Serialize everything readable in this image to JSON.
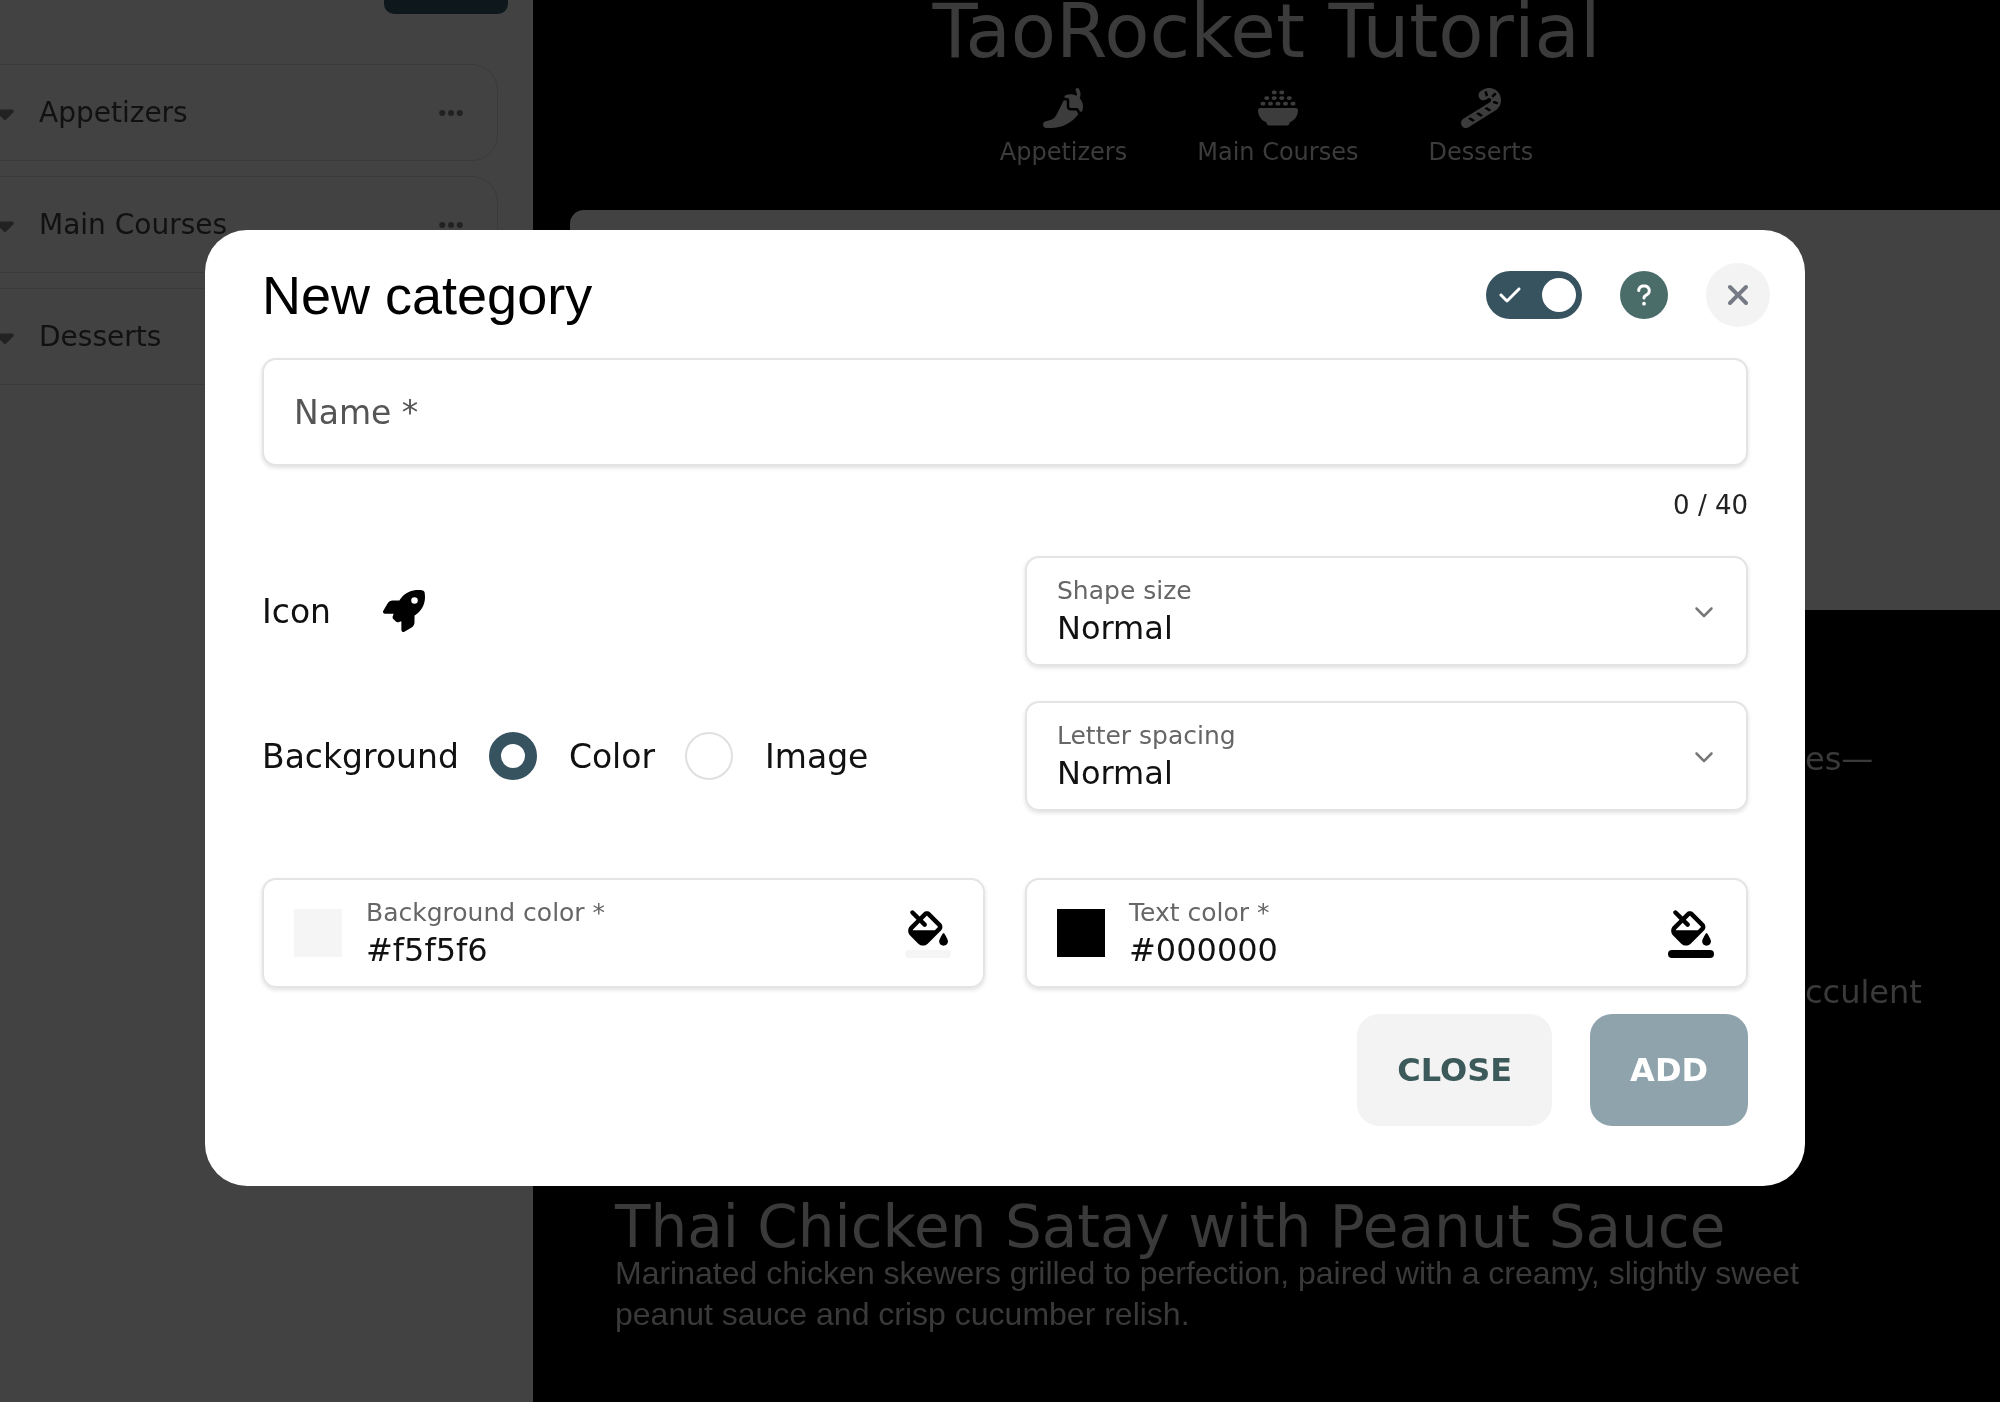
{
  "sidebar": {
    "items": [
      {
        "label": "Appetizers",
        "more_button": true
      },
      {
        "label": "Main Courses",
        "more_button": true
      },
      {
        "label": "Desserts"
      }
    ]
  },
  "page": {
    "title": "TaoRocket Tutorial",
    "nav": [
      {
        "kind": "pepper",
        "label": "Appetizers"
      },
      {
        "kind": "bowl",
        "label": "Main Courses"
      },
      {
        "kind": "candy",
        "label": "Desserts"
      }
    ],
    "snippets": [
      "es—",
      "cculent"
    ],
    "recipe": {
      "title": "Thai Chicken Satay with Peanut Sauce",
      "description": "Marinated chicken skewers grilled to perfection, paired with a creamy, slightly sweet peanut sauce and crisp cucumber relish."
    }
  },
  "dialog": {
    "title": "New category",
    "toggle": {
      "on": true
    },
    "name_field": {
      "placeholder": "Name *",
      "counter": "0 / 40"
    },
    "icon": {
      "label": "Icon"
    },
    "background": {
      "label": "Background",
      "options": [
        {
          "label": "Color",
          "selected": true
        },
        {
          "label": "Image",
          "selected": false
        }
      ]
    },
    "selects": [
      {
        "label": "Shape size",
        "value": "Normal"
      },
      {
        "label": "Letter spacing",
        "value": "Normal"
      }
    ],
    "color_fields": [
      {
        "label": "Background color *",
        "value": "#f5f5f6",
        "color": "#f5f5f6"
      },
      {
        "label": "Text color *",
        "value": "#000000",
        "color": "#000000"
      }
    ],
    "buttons": [
      {
        "label": "CLOSE",
        "kind": "secondary",
        "disabled": false
      },
      {
        "label": "ADD",
        "kind": "primary",
        "disabled": true
      }
    ]
  }
}
